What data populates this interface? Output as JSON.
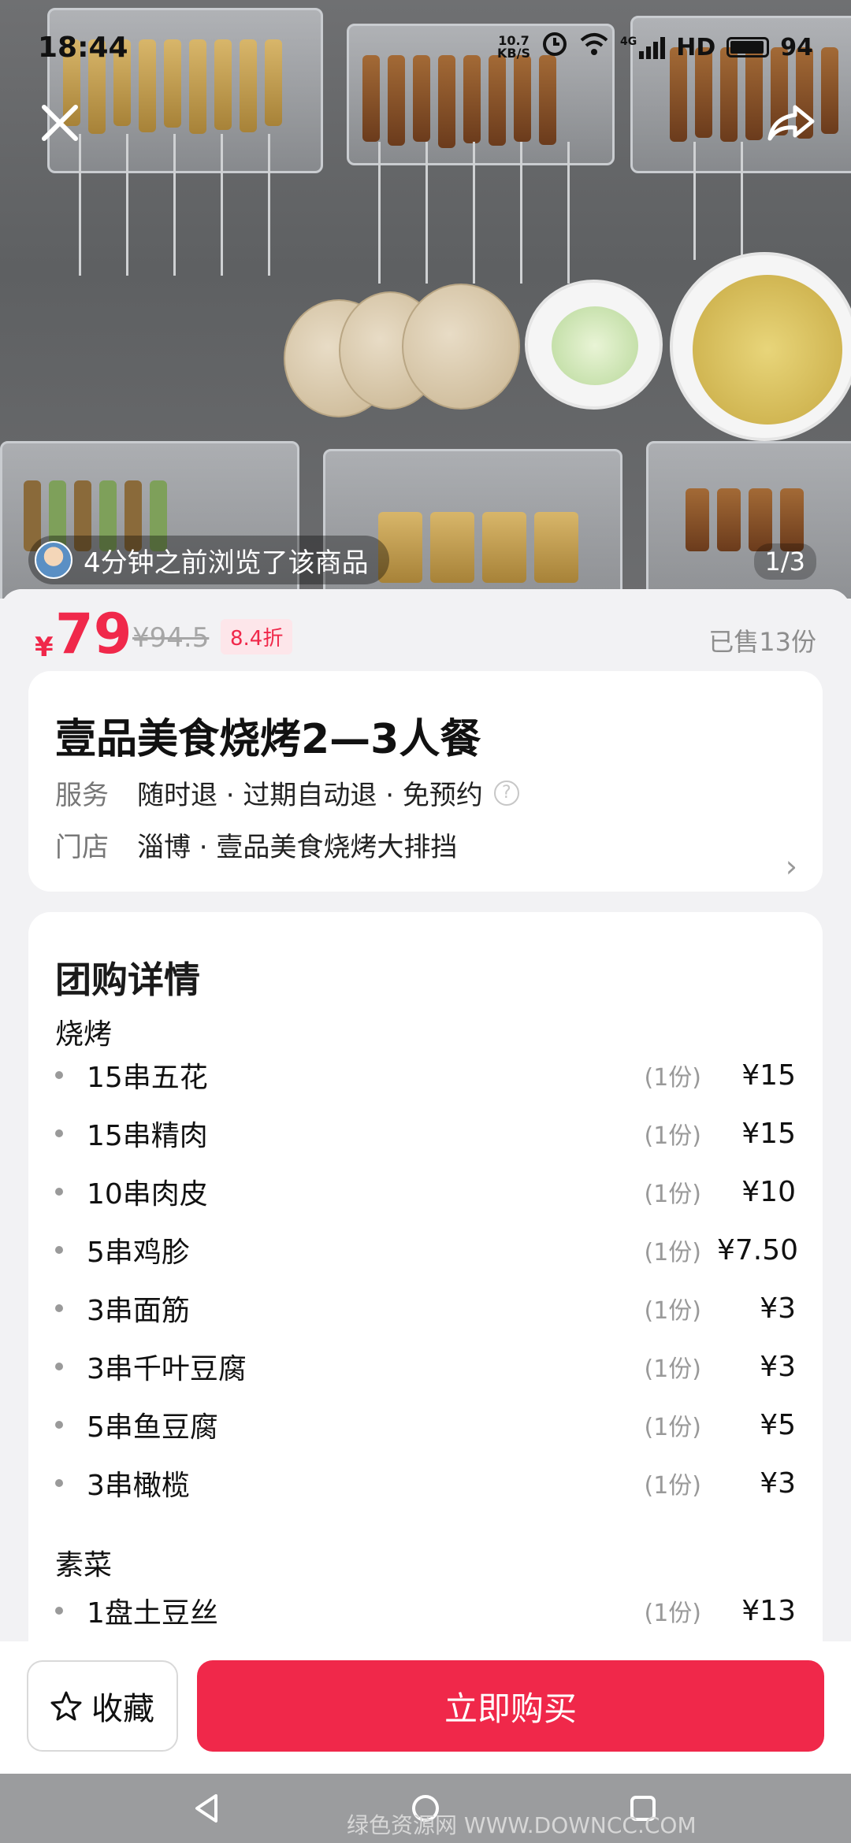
{
  "status": {
    "time": "18:44",
    "net_speed_top": "10.7",
    "net_speed_unit": "KB/S",
    "signal_gen": "4G",
    "hd": "HD",
    "battery": "94"
  },
  "hero": {
    "viewer_text": "4分钟之前浏览了该商品",
    "page_counter": "1/3"
  },
  "price": {
    "symbol": "¥",
    "current": "79",
    "original": "¥94.5",
    "discount": "8.4折",
    "sold": "已售13份"
  },
  "product": {
    "title": "壹品美食烧烤2—3人餐",
    "service_key": "服务",
    "service_value": "随时退 · 过期自动退 · 免预约",
    "store_key": "门店",
    "store_value": "淄博 · 壹品美食烧烤大排挡"
  },
  "details": {
    "section_title": "团购详情",
    "groups": [
      {
        "title": "烧烤",
        "items": [
          {
            "name": "15串五花",
            "qty": "(1份)",
            "price": "¥15"
          },
          {
            "name": "15串精肉",
            "qty": "(1份)",
            "price": "¥15"
          },
          {
            "name": "10串肉皮",
            "qty": "(1份)",
            "price": "¥10"
          },
          {
            "name": "5串鸡胗",
            "qty": "(1份)",
            "price": "¥7.50"
          },
          {
            "name": "3串面筋",
            "qty": "(1份)",
            "price": "¥3"
          },
          {
            "name": "3串千叶豆腐",
            "qty": "(1份)",
            "price": "¥3"
          },
          {
            "name": "5串鱼豆腐",
            "qty": "(1份)",
            "price": "¥5"
          },
          {
            "name": "3串橄榄",
            "qty": "(1份)",
            "price": "¥3"
          }
        ]
      },
      {
        "title": "素菜",
        "items": [
          {
            "name": "1盘土豆丝",
            "qty": "(1份)",
            "price": "¥13"
          }
        ]
      }
    ]
  },
  "bottom": {
    "favorite_label": "收藏",
    "buy_label": "立即购买"
  },
  "watermark": "绿色资源网 WWW.DOWNCC.COM",
  "colors": {
    "accent": "#f0284a",
    "discount_bg": "#fde6ea"
  }
}
